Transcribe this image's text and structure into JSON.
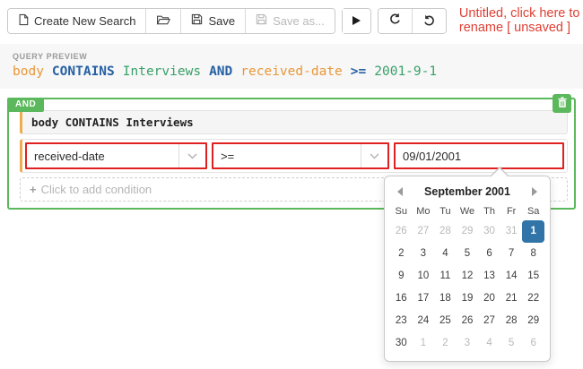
{
  "toolbar": {
    "create_new_search_label": "Create New Search",
    "save_label": "Save",
    "save_as_label": "Save as...",
    "title_text": "Untitled, click here to rename [ unsaved ]",
    "icons": [
      "new-document-icon",
      "open-folder-icon",
      "save-icon",
      "save-as-icon",
      "run-icon",
      "undo-icon",
      "redo-icon"
    ]
  },
  "preview": {
    "label": "QUERY PREVIEW",
    "tokens": [
      {
        "text": "body",
        "type": "field"
      },
      {
        "text": "CONTAINS",
        "type": "keyword"
      },
      {
        "text": "Interviews",
        "type": "value"
      },
      {
        "text": "AND",
        "type": "keyword"
      },
      {
        "text": "received-date",
        "type": "field"
      },
      {
        "text": ">=",
        "type": "keyword"
      },
      {
        "text": "2001-9-1",
        "type": "value"
      }
    ]
  },
  "builder": {
    "group_operator": "AND",
    "condition1_text": "body CONTAINS Interviews",
    "field_selected": "received-date",
    "operator_selected": ">=",
    "date_value": "09/01/2001",
    "add_condition_plus": "+",
    "add_condition_label": "Click to add condition"
  },
  "datepicker": {
    "month_label": "September 2001",
    "day_headers": [
      "Su",
      "Mo",
      "Tu",
      "We",
      "Th",
      "Fr",
      "Sa"
    ],
    "weeks": [
      [
        {
          "label": "26",
          "muted": true
        },
        {
          "label": "27",
          "muted": true
        },
        {
          "label": "28",
          "muted": true
        },
        {
          "label": "29",
          "muted": true
        },
        {
          "label": "30",
          "muted": true
        },
        {
          "label": "31",
          "muted": true
        },
        {
          "label": "1",
          "selected": true
        }
      ],
      [
        {
          "label": "2"
        },
        {
          "label": "3"
        },
        {
          "label": "4"
        },
        {
          "label": "5"
        },
        {
          "label": "6"
        },
        {
          "label": "7"
        },
        {
          "label": "8"
        }
      ],
      [
        {
          "label": "9"
        },
        {
          "label": "10"
        },
        {
          "label": "11"
        },
        {
          "label": "12"
        },
        {
          "label": "13"
        },
        {
          "label": "14"
        },
        {
          "label": "15"
        }
      ],
      [
        {
          "label": "16"
        },
        {
          "label": "17"
        },
        {
          "label": "18"
        },
        {
          "label": "19"
        },
        {
          "label": "20"
        },
        {
          "label": "21"
        },
        {
          "label": "22"
        }
      ],
      [
        {
          "label": "23"
        },
        {
          "label": "24"
        },
        {
          "label": "25"
        },
        {
          "label": "26"
        },
        {
          "label": "27"
        },
        {
          "label": "28"
        },
        {
          "label": "29"
        }
      ],
      [
        {
          "label": "30"
        },
        {
          "label": "1",
          "muted": true
        },
        {
          "label": "2",
          "muted": true
        },
        {
          "label": "3",
          "muted": true
        },
        {
          "label": "4",
          "muted": true
        },
        {
          "label": "5",
          "muted": true
        },
        {
          "label": "6",
          "muted": true
        }
      ]
    ]
  },
  "colors": {
    "group_green": "#5cb85c",
    "warning_orange": "#f0ad4e",
    "error_red_border": "#df2020",
    "title_red": "#e03e32",
    "token_field_orange": "#e8983a",
    "token_keyword_blue": "#2660a4",
    "token_value_green": "#38a169",
    "selected_day_blue": "#3074a8"
  }
}
